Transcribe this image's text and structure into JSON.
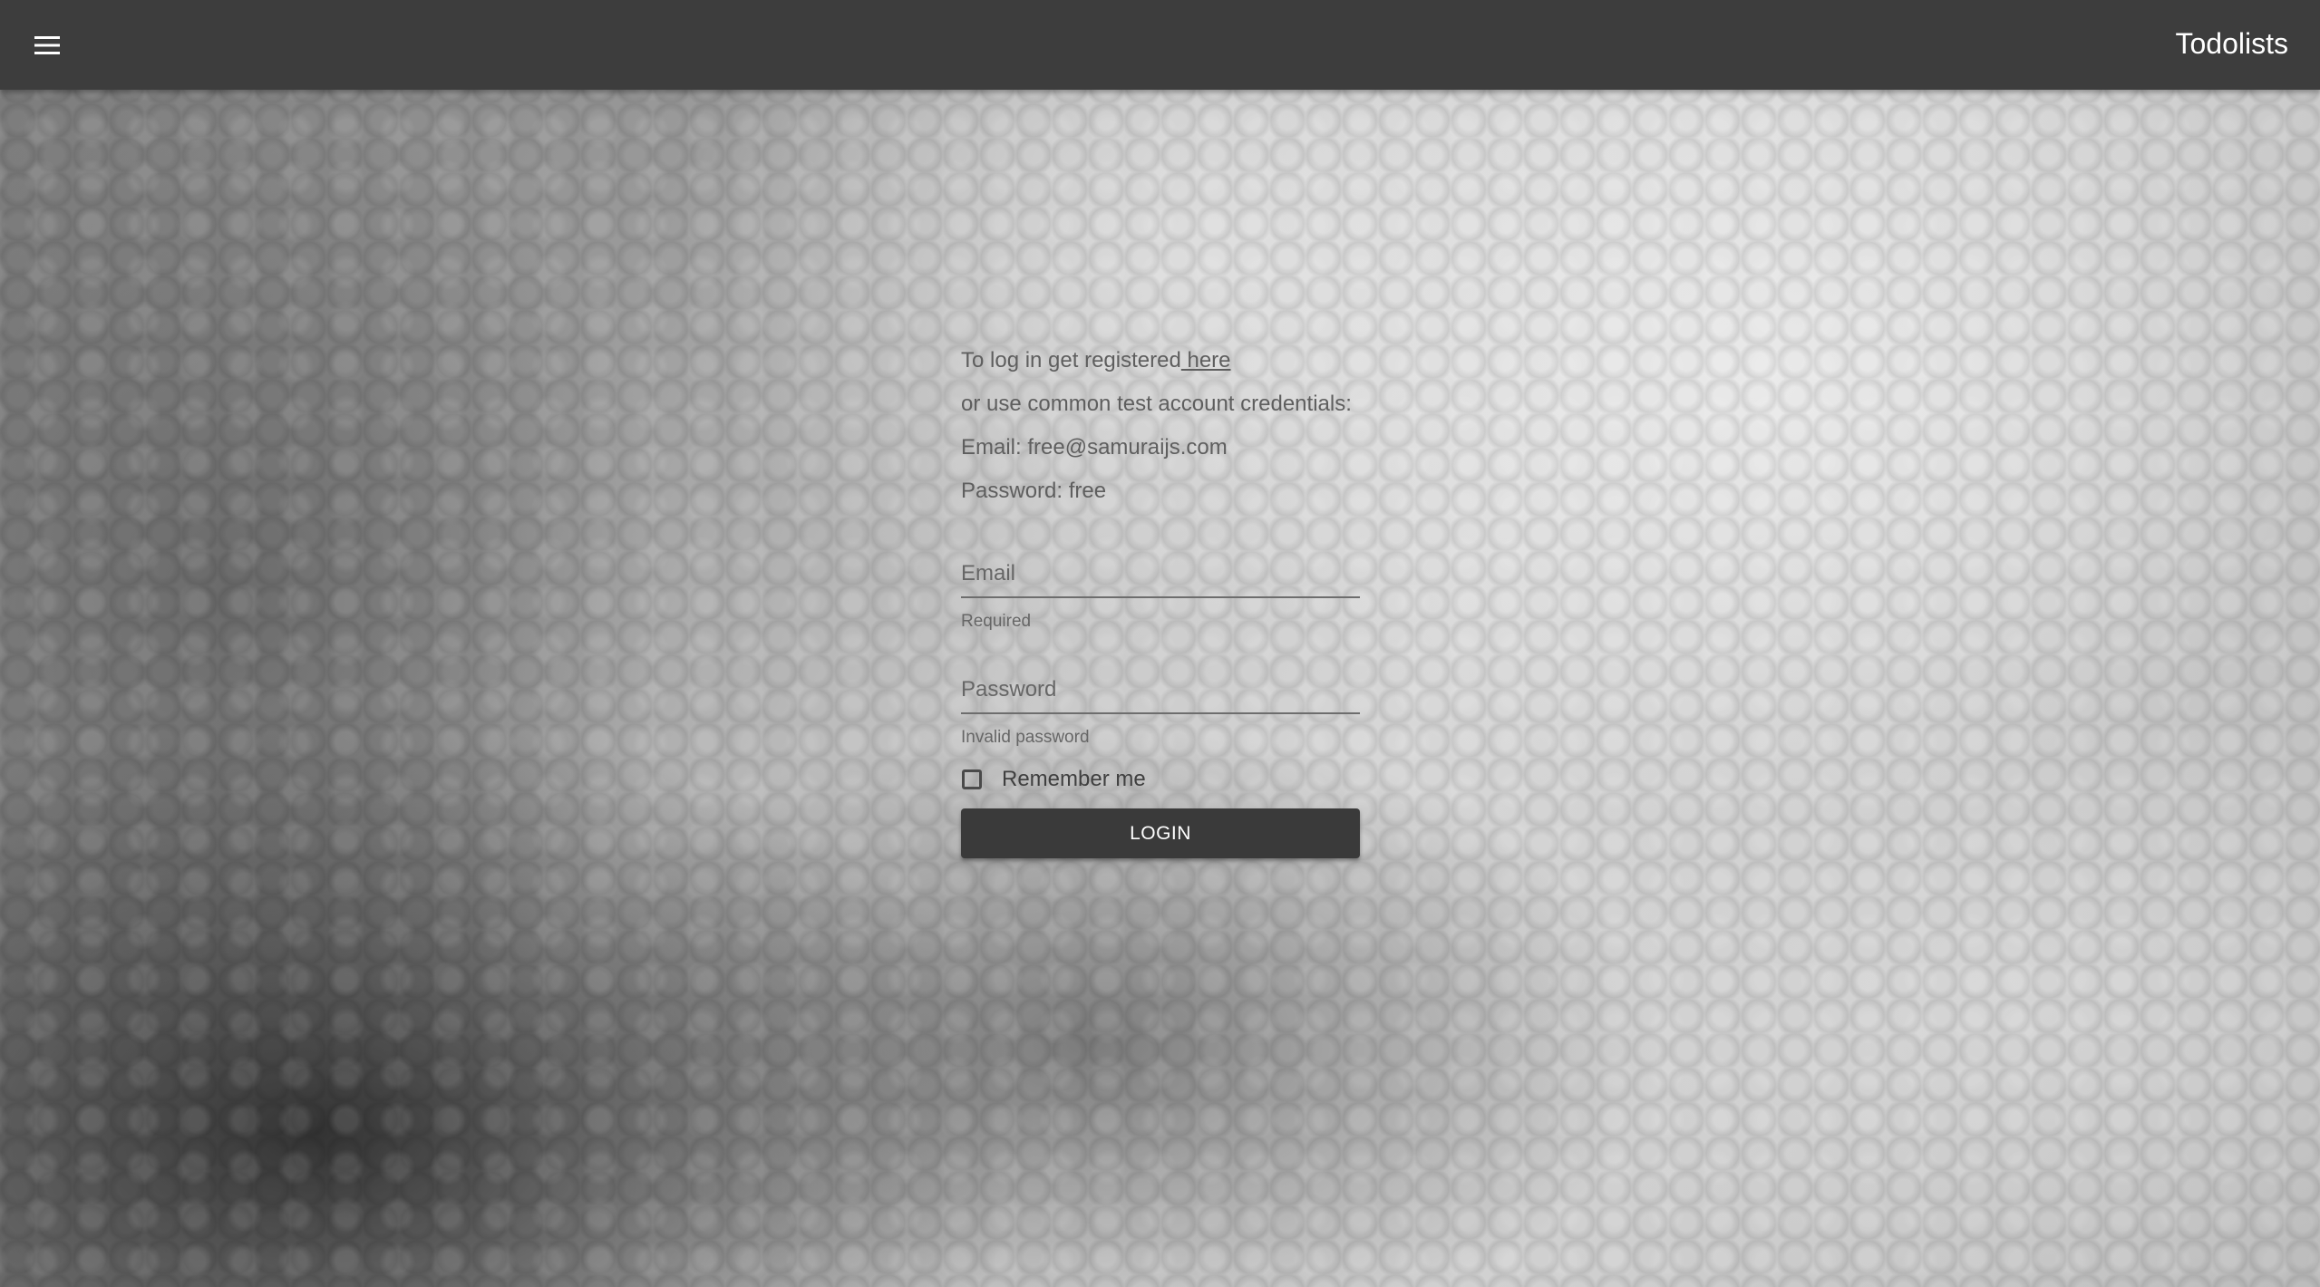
{
  "app_bar": {
    "menu_icon": "hamburger-menu-icon",
    "title": "Todolists",
    "background_color": "#3d3d3d"
  },
  "login_form": {
    "info": {
      "line1_text": "To log in get registered",
      "line1_link": " here",
      "line2": "or use common test account credentials:",
      "line3": "Email: free@samuraijs.com",
      "line4": "Password: free"
    },
    "email": {
      "placeholder": "Email",
      "value": "",
      "helper": "Required"
    },
    "password": {
      "placeholder": "Password",
      "value": "",
      "helper": "Invalid password"
    },
    "remember_me": {
      "label": "Remember me",
      "checked": false
    },
    "login_button": "LOGIN",
    "button_color": "#3a3a3a"
  }
}
